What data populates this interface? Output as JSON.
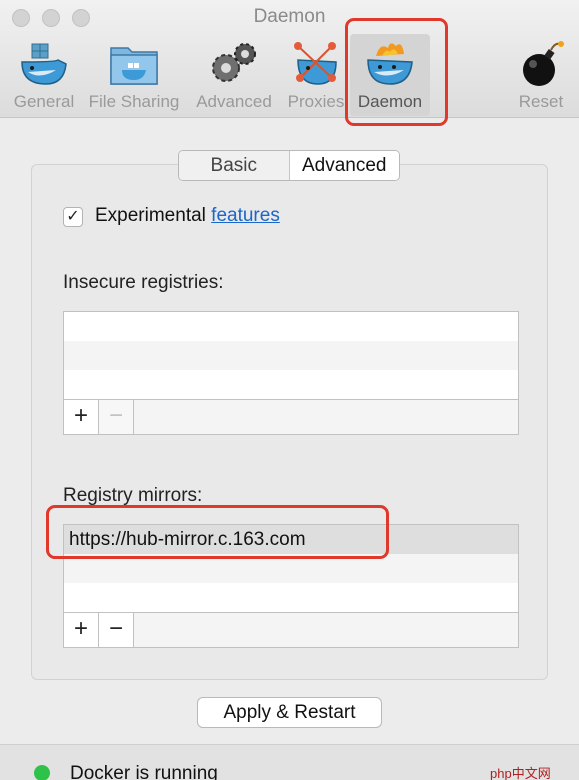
{
  "window": {
    "title": "Daemon"
  },
  "toolbar": {
    "items": [
      {
        "label": "General",
        "icon": "docker-whale-icon"
      },
      {
        "label": "File Sharing",
        "icon": "folder-whale-icon"
      },
      {
        "label": "Advanced",
        "icon": "gears-icon"
      },
      {
        "label": "Proxies",
        "icon": "network-whale-icon"
      },
      {
        "label": "Daemon",
        "icon": "flame-whale-icon",
        "selected": true
      },
      {
        "label": "Reset",
        "icon": "bomb-icon"
      }
    ]
  },
  "tabs": {
    "basic": "Basic",
    "advanced": "Advanced",
    "active": "Advanced"
  },
  "experimental": {
    "checked": true,
    "check_glyph": "✓",
    "label": "Experimental",
    "link": "features"
  },
  "insecure_registries": {
    "label": "Insecure registries:",
    "entries": []
  },
  "registry_mirrors": {
    "label": "Registry mirrors:",
    "entries": [
      "https://hub-mirror.c.163.com"
    ]
  },
  "list_controls": {
    "add": "+",
    "remove": "−"
  },
  "apply_button": "Apply & Restart",
  "status": {
    "text": "Docker is running",
    "color": "#2fc24a"
  },
  "watermark": "php中文网",
  "colors": {
    "highlight": "#e0382b",
    "link": "#1a66c9"
  }
}
